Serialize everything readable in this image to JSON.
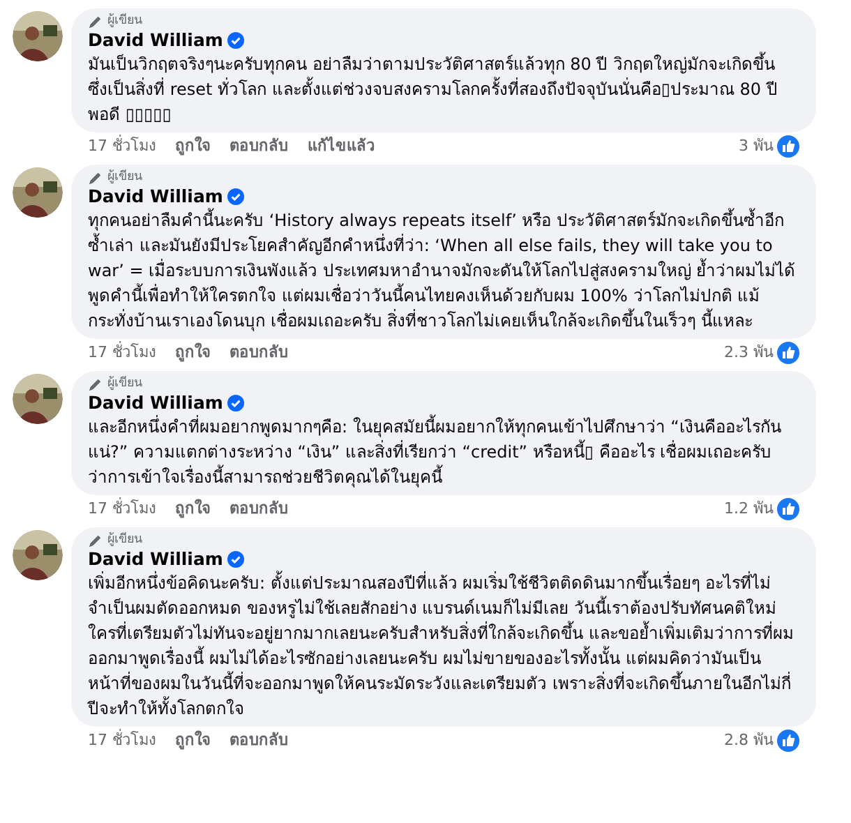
{
  "comments": [
    {
      "badge": "ผู้เขียน",
      "name": "David William",
      "verified": true,
      "text": "มันเป็นวิกฤตจริงๆนะครับทุกคน อย่าลืมว่าตามประวัติศาสตร์แล้วทุก 80 ปี วิกฤตใหญ่มักจะเกิดขึ้น ซึ่งเป็นสิ่งที่ reset ทั่วโลก และตั้งแต่ช่วงจบสงครามโลกครั้งที่สองถึงปัจจุบันนั่นคือ▯ประมาณ 80 ปีพอดี ▯▯▯▯▯",
      "time": "17 ชั่วโมง",
      "actions": [
        "ถูกใจ",
        "ตอบกลับ",
        "แก้ไขแล้ว"
      ],
      "reactions": "3 พัน"
    },
    {
      "badge": "ผู้เขียน",
      "name": "David William",
      "verified": true,
      "text": "ทุกคนอย่าลืมคำนี้นะครับ ‘History always repeats itself’ หรือ ประวัติศาสตร์มักจะเกิดขึ้นซ้ำอีกซ้ำเล่า และมันยังมีประโยคสำคัญอีกคำหนึ่งที่ว่า: ‘When all else fails, they will take you to war’ = เมื่อระบบการเงินพังแล้ว ประเทศมหาอำนาจมักจะดันให้โลกไปสู่สงครามใหญ่ ย้ำว่าผมไม่ได้พูดคำนี้เพื่อทำให้ใครตกใจ แต่ผมเชื่อว่าวันนี้คนไทยคงเห็นด้วยกับผม 100% ว่าโลกไม่ปกติ แม้กระทั่งบ้านเราเองโดนบุก เชื่อผมเถอะครับ สิ่งที่ชาวโลกไม่เคยเห็นใกล้จะเกิดขึ้นในเร็วๆ นี้แหละ",
      "time": "17 ชั่วโมง",
      "actions": [
        "ถูกใจ",
        "ตอบกลับ"
      ],
      "reactions": "2.3 พัน"
    },
    {
      "badge": "ผู้เขียน",
      "name": "David William",
      "verified": true,
      "text": "และอีกหนึ่งคำที่ผมอยากพูดมากๆคือ: ในยุคสมัยนี้ผมอยากให้ทุกคนเข้าไปศึกษาว่า “เงินคืออะไรกันแน่?” ความแตกต่างระหว่าง “เงิน” และสิ่งที่เรียกว่า “credit” หรือหนี้▯ คืออะไร เชื่อผมเถอะครับว่าการเข้าใจเรื่องนี้สามารถช่วยชีวิตคุณได้ในยุคนี้",
      "time": "17 ชั่วโมง",
      "actions": [
        "ถูกใจ",
        "ตอบกลับ"
      ],
      "reactions": "1.2 พัน"
    },
    {
      "badge": "ผู้เขียน",
      "name": "David William",
      "verified": true,
      "text": "เพิ่มอีกหนึ่งข้อคิดนะครับ: ตั้งแต่ประมาณสองปีที่แล้ว ผมเริ่มใช้ชีวิตติดดินมากขึ้นเรื่อยๆ อะไรที่ไม่จำเป็นผมตัดออกหมด ของหรูไม่ใช้เลยสักอย่าง แบรนด์เนมก็ไม่มีเลย วันนี้เราต้องปรับทัศนคติใหม่ ใครที่เตรียมตัวไม่ทันจะอยู่ยากมากเลยนะครับสำหรับสิ่งที่ใกล้จะเกิดขึ้น และขอย้ำเพิ่มเติมว่าการที่ผมออกมาพูดเรื่องนี้ ผมไม่ได้อะไรซักอย่างเลยนะครับ ผมไม่ขายของอะไรทั้งนั้น แต่ผมคิดว่ามันเป็นหน้าที่ของผมในวันนี้ที่จะออกมาพูดให้คนระมัดระวังและเตรียมตัว เพราะสิ่งที่จะเกิดขึ้นภายในอีกไม่กี่ปีจะทำให้ทั้งโลกตกใจ",
      "time": "17 ชั่วโมง",
      "actions": [
        "ถูกใจ",
        "ตอบกลับ"
      ],
      "reactions": "2.8 พัน"
    }
  ]
}
